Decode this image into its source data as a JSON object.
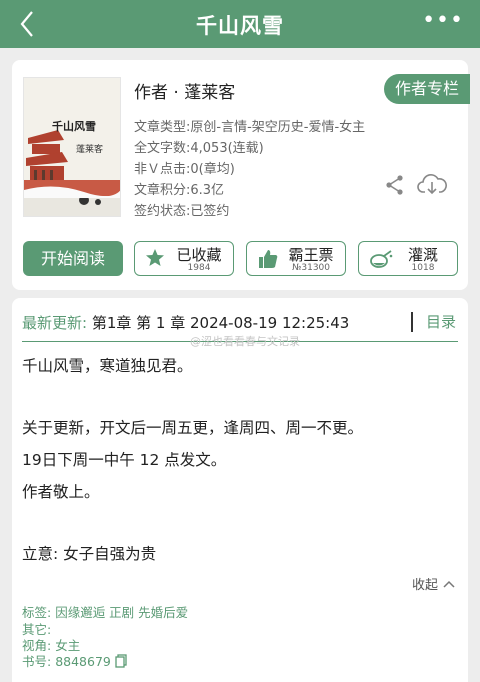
{
  "header": {
    "title": "千山风雪",
    "more": "•••"
  },
  "cover": {
    "title": "千山风雪",
    "author": "蓬莱客"
  },
  "book": {
    "author_line": "作者 · 蓬莱客",
    "author_column_button": "作者专栏",
    "meta": [
      "文章类型:原创-言情-架空历史-爱情-女主",
      "全文字数:4,053(连载)",
      "非Ｖ点击:0(章均)",
      "文章积分:6.3亿",
      "签约状态:已签约"
    ]
  },
  "actions": {
    "read_label": "开始阅读",
    "items": [
      {
        "label": "已收藏",
        "sub": "1984"
      },
      {
        "label": "霸王票",
        "sub": "№31300"
      },
      {
        "label": "灌溉",
        "sub": "1018"
      }
    ]
  },
  "update": {
    "key": "最新更新:",
    "value": "第1章 第 1 章 2024-08-19 12:25:43",
    "toc_label": "目录",
    "watermark": "@涩也看看春与文记录"
  },
  "intro": {
    "paragraphs": [
      "千山风雪，寒道独见君。",
      "关于更新，开文后一周五更，逢周四、周一不更。",
      "19日下周一中午 12 点发文。",
      "作者敬上。",
      "立意: 女子自强为贵"
    ],
    "fold_label": "收起"
  },
  "tags": {
    "tags_label": "标签:",
    "tags_value": "因缘邂逅  正剧  先婚后爱",
    "other_label": "其它:",
    "other_value": "",
    "view_label": "视角:",
    "view_value": "女主",
    "bookno_label": "书号:",
    "bookno_value": "8848679"
  },
  "colors": {
    "accent": "#5a9a74",
    "background": "#ededed"
  }
}
